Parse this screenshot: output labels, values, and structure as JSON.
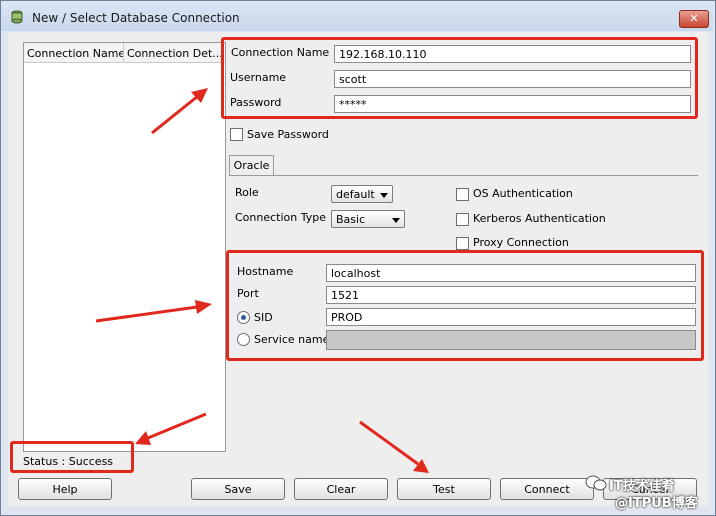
{
  "window": {
    "title": "New / Select Database Connection",
    "close_symbol": "✕"
  },
  "list": {
    "columns": [
      "Connection Name",
      "Connection Det..."
    ]
  },
  "form": {
    "connection_name_label": "Connection Name",
    "connection_name_value": "192.168.10.110",
    "username_label": "Username",
    "username_value": "scott",
    "password_label": "Password",
    "password_value": "*****",
    "save_password_label": "Save Password",
    "save_password_checked": false
  },
  "tabs": [
    {
      "label": "Oracle",
      "selected": true
    }
  ],
  "oracle": {
    "role_label": "Role",
    "role_value": "default",
    "conn_type_label": "Connection Type",
    "conn_type_value": "Basic",
    "os_auth_label": "OS Authentication",
    "kerberos_label": "Kerberos Authentication",
    "proxy_label": "Proxy Connection",
    "hostname_label": "Hostname",
    "hostname_value": "localhost",
    "port_label": "Port",
    "port_value": "1521",
    "sid_label": "SID",
    "sid_value": "PROD",
    "sid_selected": true,
    "service_label": "Service name",
    "service_value": ""
  },
  "status": {
    "text": "Status : Success"
  },
  "buttons": {
    "help": "Help",
    "save": "Save",
    "clear": "Clear",
    "test": "Test",
    "connect": "Connect",
    "cancel": "Cancel"
  },
  "watermark": {
    "line1": "IT技术佳肴",
    "line2": "@ITPUB博客"
  },
  "colors": {
    "highlight": "#e0281d",
    "accent": "#2f5d9e"
  }
}
